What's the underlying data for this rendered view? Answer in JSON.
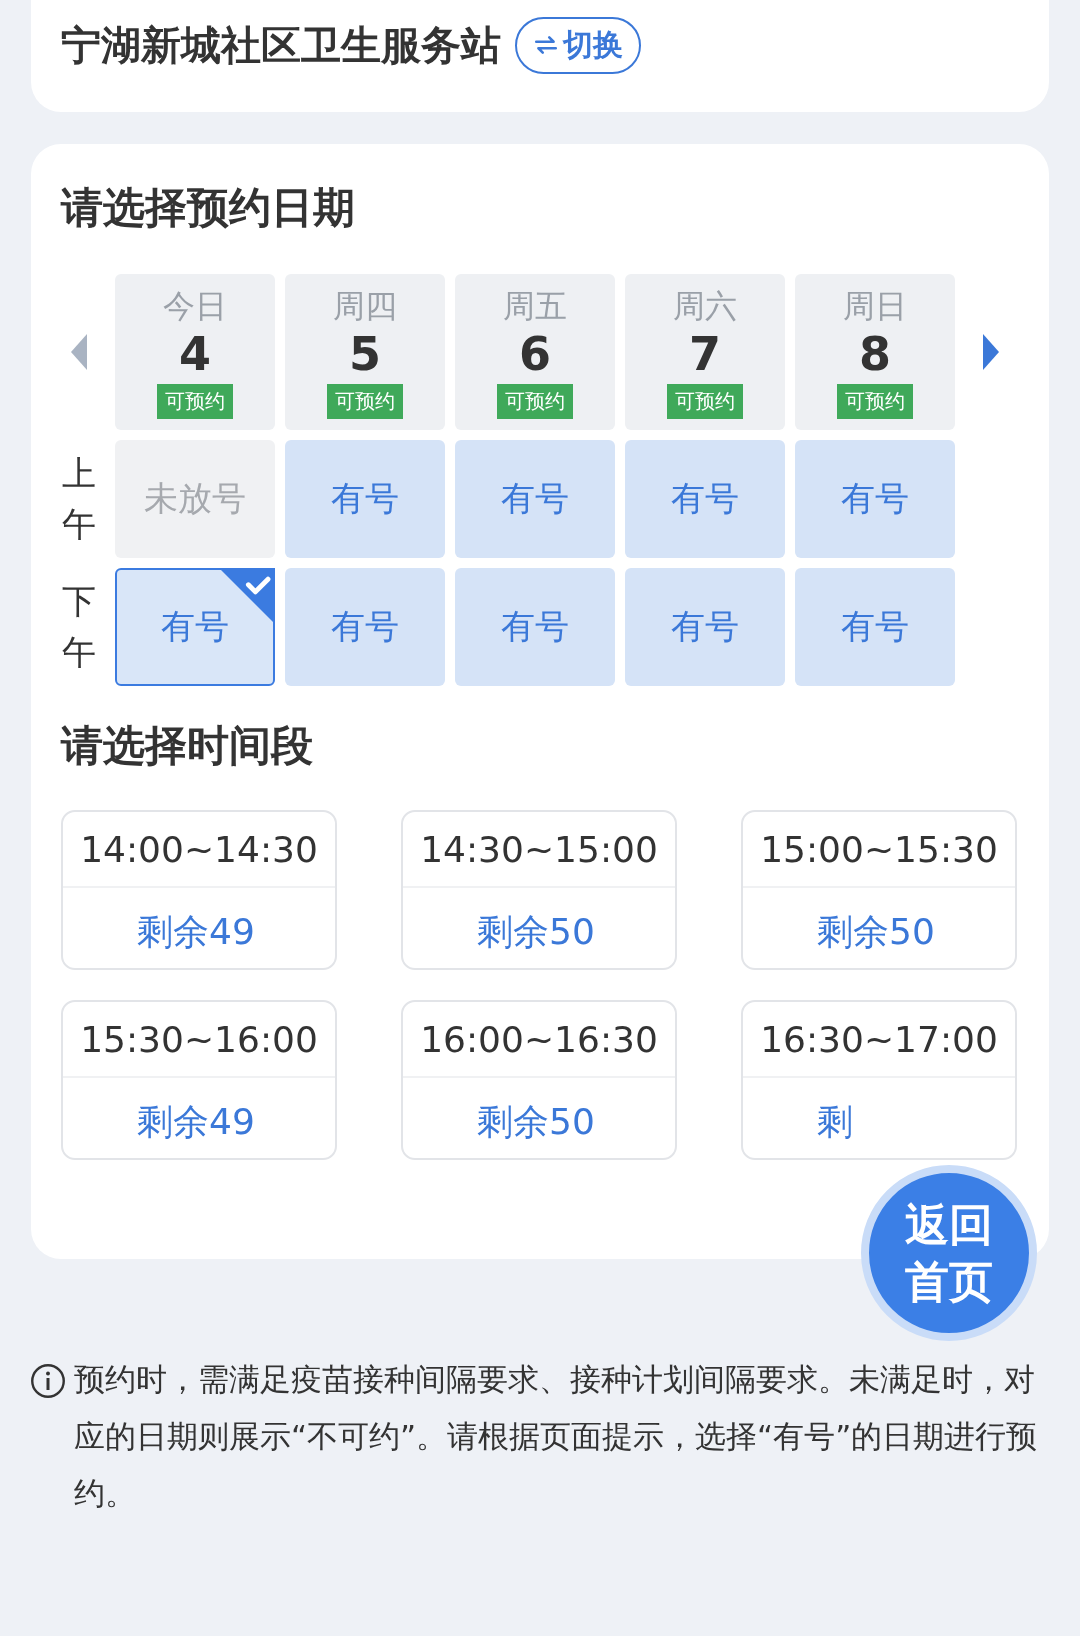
{
  "header": {
    "title": "宁湖新城社区卫生服务站",
    "switch_label": "切换"
  },
  "date_section": {
    "heading": "请选择预约日期",
    "prev_arrow": {
      "disabled": true
    },
    "next_arrow": {
      "disabled": false
    },
    "dates": [
      {
        "weekday": "今日",
        "day": "4",
        "status": "可预约"
      },
      {
        "weekday": "周四",
        "day": "5",
        "status": "可预约"
      },
      {
        "weekday": "周五",
        "day": "6",
        "status": "可预约"
      },
      {
        "weekday": "周六",
        "day": "7",
        "status": "可预约"
      },
      {
        "weekday": "周日",
        "day": "8",
        "status": "可预约"
      }
    ],
    "periods": [
      {
        "label": "上午",
        "cells": [
          {
            "text": "未放号",
            "kind": "unreleased",
            "selected": false
          },
          {
            "text": "有号",
            "kind": "available",
            "selected": false
          },
          {
            "text": "有号",
            "kind": "available",
            "selected": false
          },
          {
            "text": "有号",
            "kind": "available",
            "selected": false
          },
          {
            "text": "有号",
            "kind": "available",
            "selected": false
          }
        ]
      },
      {
        "label": "下午",
        "cells": [
          {
            "text": "有号",
            "kind": "available",
            "selected": true
          },
          {
            "text": "有号",
            "kind": "available",
            "selected": false
          },
          {
            "text": "有号",
            "kind": "available",
            "selected": false
          },
          {
            "text": "有号",
            "kind": "available",
            "selected": false
          },
          {
            "text": "有号",
            "kind": "available",
            "selected": false
          }
        ]
      }
    ]
  },
  "time_section": {
    "heading": "请选择时间段",
    "slots": [
      {
        "time": "14:00~14:30",
        "remaining": "剩余49"
      },
      {
        "time": "14:30~15:00",
        "remaining": "剩余50"
      },
      {
        "time": "15:00~15:30",
        "remaining": "剩余50"
      },
      {
        "time": "15:30~16:00",
        "remaining": "剩余49"
      },
      {
        "time": "16:00~16:30",
        "remaining": "剩余50"
      },
      {
        "time": "16:30~17:00",
        "remaining": "剩"
      }
    ]
  },
  "home_button": {
    "label": "返回首页"
  },
  "notice": {
    "text": "预约时，需满足疫苗接种间隔要求、接种计划间隔要求。未满足时，对应的日期则展示“不可约”。请根据页面提示，选择“有号”的日期进行预约。"
  }
}
